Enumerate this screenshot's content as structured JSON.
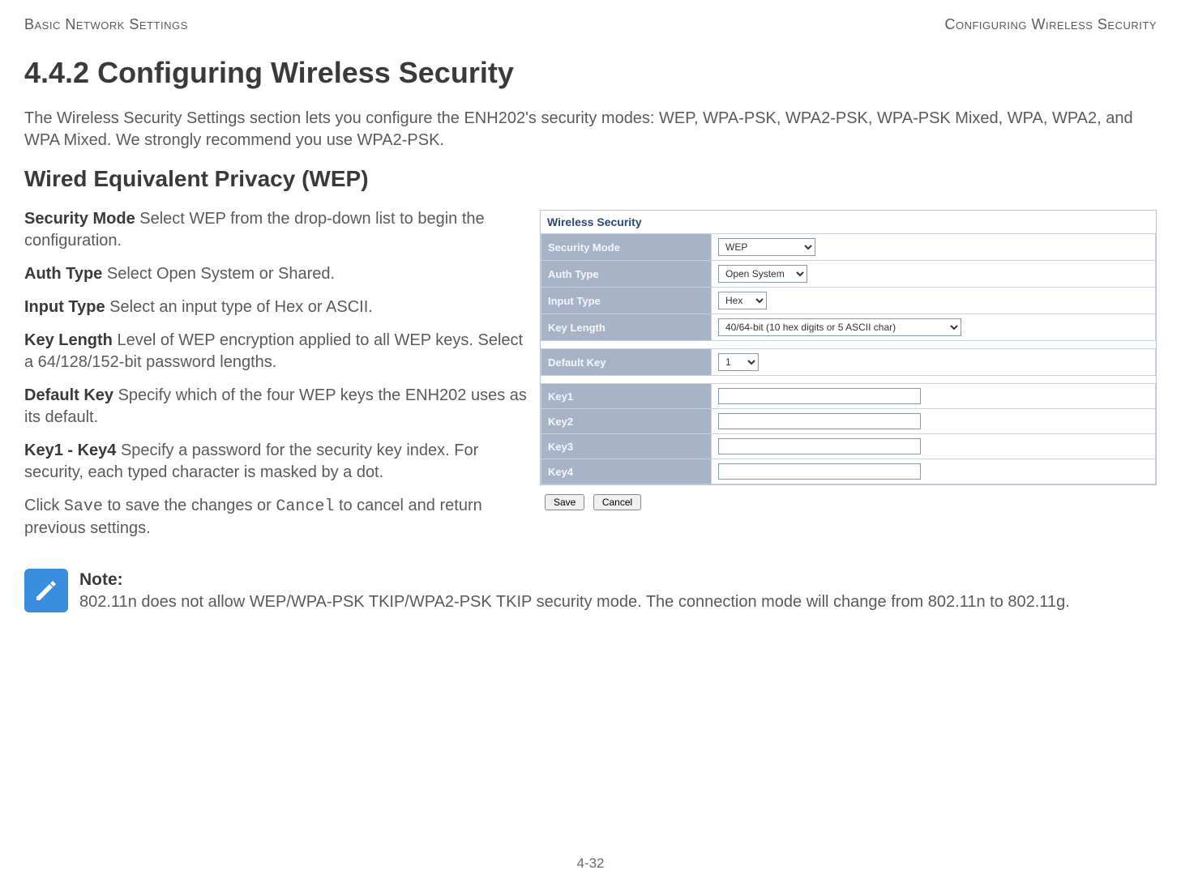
{
  "header": {
    "left": "Basic Network Settings",
    "right": "Configuring Wireless Security"
  },
  "section_number": "4.4.2",
  "section_title": "4.4.2 Configuring Wireless Security",
  "intro": "The Wireless Security Settings section lets you configure the ENH202's security modes: WEP, WPA-PSK, WPA2-PSK, WPA-PSK Mixed, WPA, WPA2, and WPA Mixed. We strongly recommend you use WPA2-PSK.",
  "subsection_title": "Wired Equivalent Privacy (WEP)",
  "defs": {
    "security_mode": {
      "term": "Security Mode",
      "text": "  Select WEP from the drop-down list to begin the configuration."
    },
    "auth_type": {
      "term": "Auth Type",
      "text": "  Select Open System or Shared."
    },
    "input_type": {
      "term": "Input Type",
      "text": "  Select an input type of Hex or ASCII."
    },
    "key_length": {
      "term": "Key Length",
      "text": "  Level of WEP encryption applied to all WEP keys. Select a 64/128/152-bit password lengths."
    },
    "default_key": {
      "term": "Default Key",
      "text": "  Specify which of the four WEP keys the ENH202 uses as its default."
    },
    "keys": {
      "term": "Key1 - Key4",
      "text": "  Specify a password for the security key index. For security, each typed character is masked by a dot."
    },
    "save_cancel_pre": "Click ",
    "save_cancel_mid": " to save the changes or ",
    "save_cancel_post": " to cancel and return previous settings.",
    "save_word": "Save",
    "cancel_word": "Cancel"
  },
  "panel": {
    "title": "Wireless Security",
    "rows": {
      "security_mode": {
        "label": "Security Mode",
        "value": "WEP"
      },
      "auth_type": {
        "label": "Auth Type",
        "value": "Open System"
      },
      "input_type": {
        "label": "Input Type",
        "value": "Hex"
      },
      "key_length": {
        "label": "Key Length",
        "value": "40/64-bit (10 hex digits or 5 ASCII char)"
      },
      "default_key": {
        "label": "Default Key",
        "value": "1"
      },
      "key1": {
        "label": "Key1",
        "value": ""
      },
      "key2": {
        "label": "Key2",
        "value": ""
      },
      "key3": {
        "label": "Key3",
        "value": ""
      },
      "key4": {
        "label": "Key4",
        "value": ""
      }
    },
    "buttons": {
      "save": "Save",
      "cancel": "Cancel"
    }
  },
  "note": {
    "title": "Note:",
    "text": "802.11n does not allow WEP/WPA-PSK TKIP/WPA2-PSK TKIP security mode. The connection mode will change from 802.11n to 802.11g."
  },
  "page_number": "4-32"
}
